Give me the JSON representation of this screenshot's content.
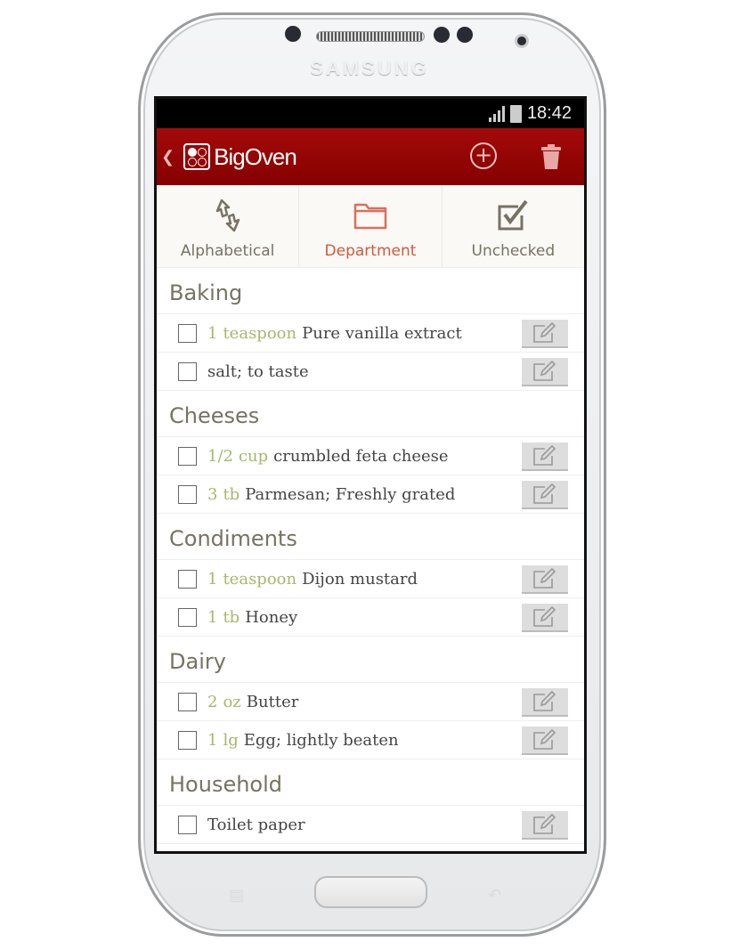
{
  "device": {
    "brand": "SAMSUNG"
  },
  "status_bar": {
    "time": "18:42"
  },
  "header": {
    "app_name": "BigOven",
    "icons": [
      "back-chevron-icon",
      "add-circle-icon",
      "trash-icon"
    ]
  },
  "sort_tabs": [
    {
      "label": "Alphabetical",
      "icon": "sort-arrows-icon",
      "active": false
    },
    {
      "label": "Department",
      "icon": "folder-icon",
      "active": true
    },
    {
      "label": "Unchecked",
      "icon": "checkbox-checked-icon",
      "active": false
    }
  ],
  "colors": {
    "header": "#8b0000",
    "active_tab": "#cf5a3c",
    "quantity": "#a6b86a"
  },
  "sections": [
    {
      "name": "Baking",
      "items": [
        {
          "qty": "1",
          "unit": "teaspoon",
          "name": "Pure vanilla extract",
          "checked": false
        },
        {
          "qty": "",
          "unit": "",
          "name": "salt; to taste",
          "checked": false
        }
      ]
    },
    {
      "name": "Cheeses",
      "items": [
        {
          "qty": "1/2",
          "unit": "cup",
          "name": "crumbled feta cheese",
          "checked": false
        },
        {
          "qty": "3",
          "unit": "tb",
          "name": "Parmesan; Freshly grated",
          "checked": false
        }
      ]
    },
    {
      "name": "Condiments",
      "items": [
        {
          "qty": "1",
          "unit": "teaspoon",
          "name": "Dijon mustard",
          "checked": false
        },
        {
          "qty": "1",
          "unit": "tb",
          "name": "Honey",
          "checked": false
        }
      ]
    },
    {
      "name": "Dairy",
      "items": [
        {
          "qty": "2",
          "unit": "oz",
          "name": "Butter",
          "checked": false
        },
        {
          "qty": "1",
          "unit": "lg",
          "name": "Egg; lightly beaten",
          "checked": false
        }
      ]
    },
    {
      "name": "Household",
      "items": [
        {
          "qty": "",
          "unit": "",
          "name": "Toilet paper",
          "checked": false
        }
      ]
    }
  ]
}
